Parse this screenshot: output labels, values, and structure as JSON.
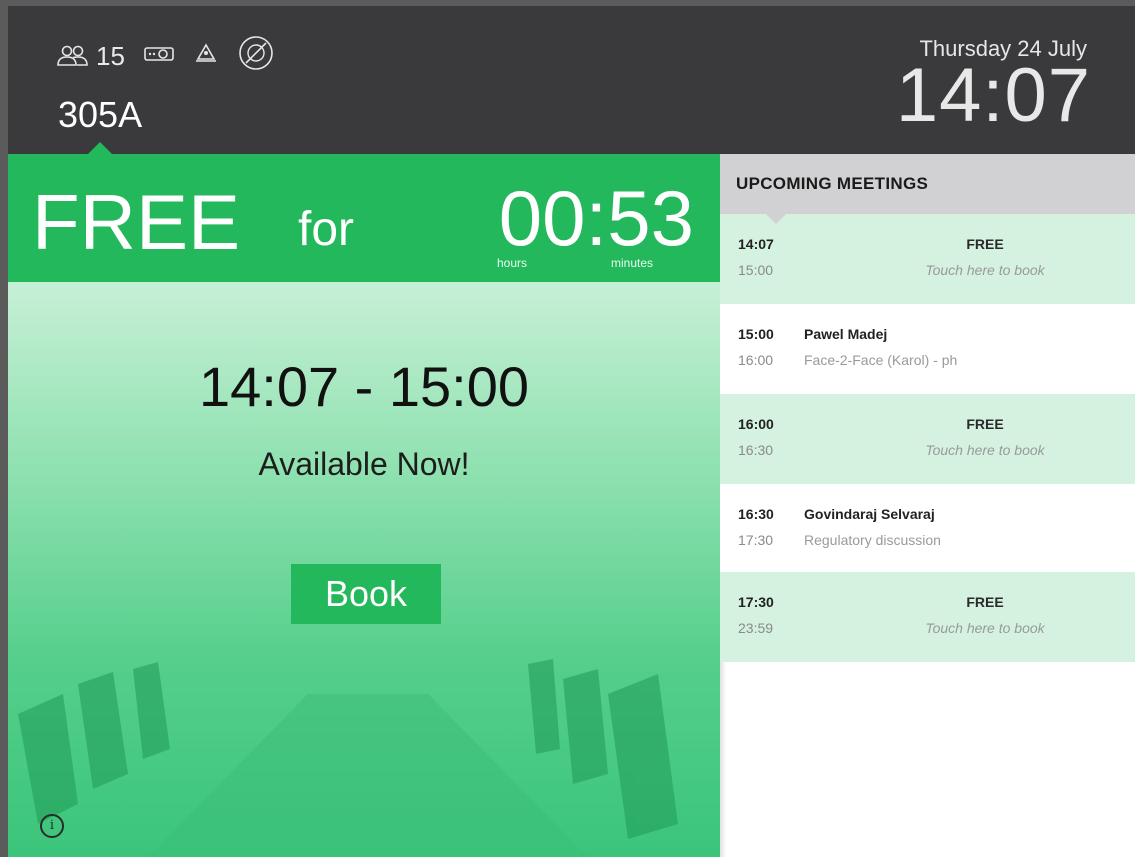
{
  "header": {
    "capacity": "15",
    "room_name": "305A",
    "date": "Thursday 24 July",
    "time": "14:07",
    "amenities": [
      "people-icon",
      "projector-icon",
      "conference-phone-icon",
      "no-food-icon"
    ]
  },
  "status": {
    "state": "FREE",
    "for_label": "for",
    "countdown": "00:53",
    "hours_label": "hours",
    "minutes_label": "minutes",
    "slot_range": "14:07 - 15:00",
    "availability_text": "Available Now!",
    "book_label": "Book"
  },
  "upcoming": {
    "title": "UPCOMING MEETINGS",
    "items": [
      {
        "start": "14:07",
        "end": "15:00",
        "type": "free",
        "title": "FREE",
        "subtitle": "Touch here to book"
      },
      {
        "start": "15:00",
        "end": "16:00",
        "type": "booked",
        "title": "Pawel Madej",
        "subtitle": "Face-2-Face (Karol) - ph"
      },
      {
        "start": "16:00",
        "end": "16:30",
        "type": "free",
        "title": "FREE",
        "subtitle": "Touch here to book"
      },
      {
        "start": "16:30",
        "end": "17:30",
        "type": "booked",
        "title": "Govindaraj Selvaraj",
        "subtitle": "Regulatory discussion"
      },
      {
        "start": "17:30",
        "end": "23:59",
        "type": "free",
        "title": "FREE",
        "subtitle": "Touch here to book"
      }
    ]
  },
  "colors": {
    "header_bg": "#3a3a3d",
    "free_green": "#22b85b",
    "free_row_bg": "#d4f2df",
    "upcoming_header_bg": "#d1d1d3"
  }
}
